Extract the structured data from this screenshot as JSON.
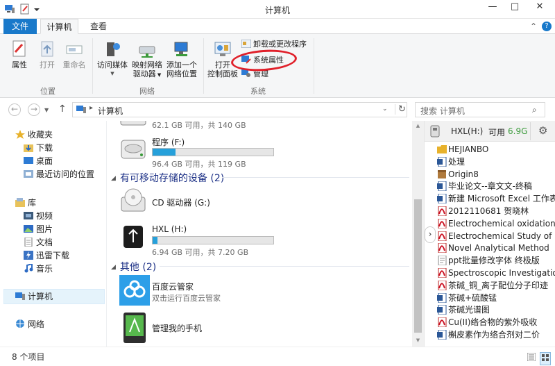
{
  "window": {
    "title": "计算机"
  },
  "tabs": {
    "file": "文件",
    "computer": "计算机",
    "view": "查看"
  },
  "ribbon": {
    "location": {
      "properties": "属性",
      "open": "打开",
      "rename": "重命名",
      "group_label": "位置"
    },
    "network": {
      "access_media": "访问媒体",
      "map_drive_line1": "映射网络",
      "map_drive_line2": "驱动器",
      "add_location_line1": "添加一个",
      "add_location_line2": "网络位置",
      "group_label": "网络"
    },
    "system": {
      "control_panel_line1": "打开",
      "control_panel_line2": "控制面板",
      "uninstall": "卸载或更改程序",
      "system_properties": "系统属性",
      "manage": "管理",
      "group_label": "系统"
    }
  },
  "address": {
    "path": "计算机",
    "search_placeholder": "搜索 计算机"
  },
  "nav": {
    "favorites": "收藏夹",
    "downloads": "下载",
    "desktop": "桌面",
    "recent": "最近访问的位置",
    "libraries": "库",
    "videos": "视频",
    "pictures": "图片",
    "documents": "文档",
    "thunder": "迅雷下载",
    "music": "音乐",
    "computer": "计算机",
    "network": "网络"
  },
  "main": {
    "top_drive_info": "62.1 GB 可用，共 140 GB",
    "drive_f": {
      "name": "程序 (F:)",
      "info": "96.4 GB 可用，共 119 GB",
      "used_fraction": 0.19
    },
    "removable_section": "有可移动存储的设备 (2)",
    "cd_drive": {
      "name": "CD 驱动器 (G:)"
    },
    "hxl_drive": {
      "name": "HXL (H:)",
      "info": "6.94 GB 可用，共 7.20 GB",
      "used_fraction": 0.04
    },
    "other_section": "其他 (2)",
    "baidu": {
      "name": "百度云管家",
      "sub": "双击运行百度云管家"
    },
    "phone": {
      "name": "管理我的手机"
    }
  },
  "preview": {
    "drive_label": "HXL(H:)",
    "free_label": "可用",
    "free_value": "6.9G",
    "items": [
      {
        "name": "HEJIANBO",
        "icon": "folder"
      },
      {
        "name": "处理",
        "icon": "word"
      },
      {
        "name": "Origin8",
        "icon": "package"
      },
      {
        "name": "毕业论文--章文文-终稿",
        "icon": "word"
      },
      {
        "name": "新建 Microsoft Excel 工作表",
        "icon": "word"
      },
      {
        "name": "2012110681 贺晓林",
        "icon": "pdf"
      },
      {
        "name": "Electrochemical oxidation",
        "icon": "pdf"
      },
      {
        "name": "Electrochemical Study of",
        "icon": "pdf"
      },
      {
        "name": "Novel Analytical Method",
        "icon": "pdf"
      },
      {
        "name": "ppt批量修改字体 终极版",
        "icon": "text"
      },
      {
        "name": "Spectroscopic Investigation",
        "icon": "pdf"
      },
      {
        "name": "茶碱_铜_离子配位分子印迹",
        "icon": "pdf"
      },
      {
        "name": "茶碱+硫酸锰",
        "icon": "word"
      },
      {
        "name": "茶碱光谱图",
        "icon": "word"
      },
      {
        "name": "Cu(II)络合物的紫外吸收",
        "icon": "pdf"
      },
      {
        "name": "槲皮素作为络合剂对二价",
        "icon": "word"
      }
    ]
  },
  "status": {
    "count": "8 个项目"
  },
  "colors": {
    "accent": "#1979ca",
    "bar_fill": "#26a0da",
    "annotation": "#e0202a"
  }
}
